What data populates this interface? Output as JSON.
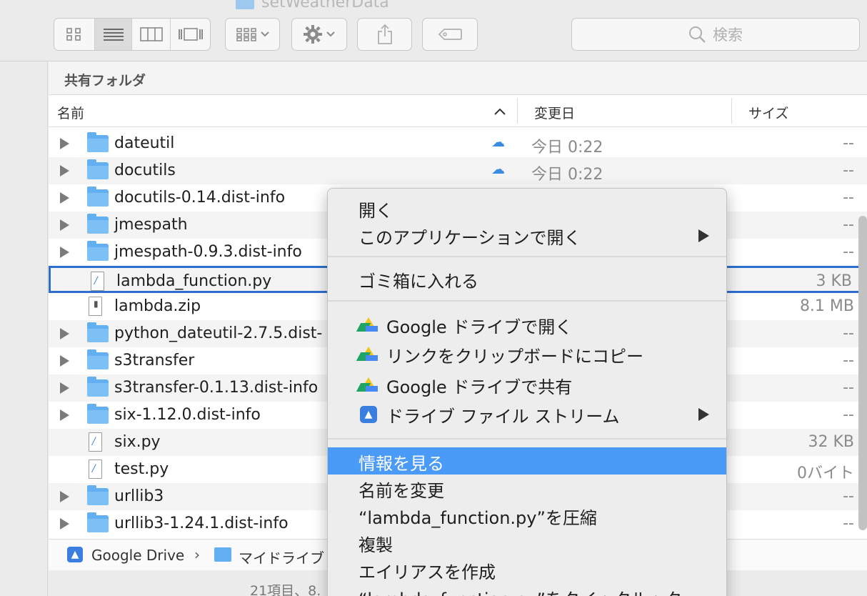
{
  "window_title": "setWeatherData",
  "toolbar": {
    "view_icons": [
      "icon-view-icon",
      "list-view-icon",
      "column-view-icon",
      "gallery-view-icon"
    ],
    "search_placeholder": "検索"
  },
  "location_header": "共有フォルダ",
  "columns": {
    "name": "名前",
    "modified": "変更日",
    "size": "サイズ"
  },
  "rows": [
    {
      "name": "dateutil",
      "kind": "folder",
      "cloud": true,
      "date": "今日 0:22",
      "size": "--"
    },
    {
      "name": "docutils",
      "kind": "folder",
      "cloud": true,
      "date": "今日 0:22",
      "size": "--"
    },
    {
      "name": "docutils-0.14.dist-info",
      "kind": "folder",
      "cloud": false,
      "date": "",
      "size": "--"
    },
    {
      "name": "jmespath",
      "kind": "folder",
      "cloud": false,
      "date": "",
      "size": "--"
    },
    {
      "name": "jmespath-0.9.3.dist-info",
      "kind": "folder",
      "cloud": false,
      "date": "",
      "size": "--"
    },
    {
      "name": "lambda_function.py",
      "kind": "file",
      "cloud": false,
      "date": "",
      "size": "3 KB"
    },
    {
      "name": "lambda.zip",
      "kind": "zip",
      "cloud": false,
      "date": "",
      "size": "8.1 MB"
    },
    {
      "name": "python_dateutil-2.7.5.dist-",
      "kind": "folder",
      "cloud": false,
      "date": "",
      "size": "--"
    },
    {
      "name": "s3transfer",
      "kind": "folder",
      "cloud": false,
      "date": "",
      "size": "--"
    },
    {
      "name": "s3transfer-0.1.13.dist-info",
      "kind": "folder",
      "cloud": false,
      "date": "",
      "size": "--"
    },
    {
      "name": "six-1.12.0.dist-info",
      "kind": "folder",
      "cloud": false,
      "date": "",
      "size": "--"
    },
    {
      "name": "six.py",
      "kind": "file",
      "cloud": false,
      "date": "",
      "size": "32 KB"
    },
    {
      "name": "test.py",
      "kind": "file",
      "cloud": false,
      "date": "",
      "size": "0バイト"
    },
    {
      "name": "urllib3",
      "kind": "folder",
      "cloud": false,
      "date": "",
      "size": "--"
    },
    {
      "name": "urllib3-1.24.1.dist-info",
      "kind": "folder",
      "cloud": false,
      "date": "",
      "size": "--"
    }
  ],
  "path_bar": {
    "root": "Google Drive",
    "child": "マイドライブ"
  },
  "status_text": "21項目、8.",
  "context_menu": {
    "open": "開く",
    "open_with": "このアプリケーションで開く",
    "trash": "ゴミ箱に入れる",
    "gdrive_open": "Google ドライブで開く",
    "copy_link": "リンクをクリップボードにコピー",
    "gdrive_share": "Google ドライブで共有",
    "drive_file_stream": "ドライブ ファイル ストリーム",
    "get_info": "情報を見る",
    "rename": "名前を変更",
    "compress": "“lambda_function.py”を圧縮",
    "duplicate": "複製",
    "make_alias": "エイリアスを作成",
    "quick_look": "“lambda_function.py”をクイックルック"
  }
}
